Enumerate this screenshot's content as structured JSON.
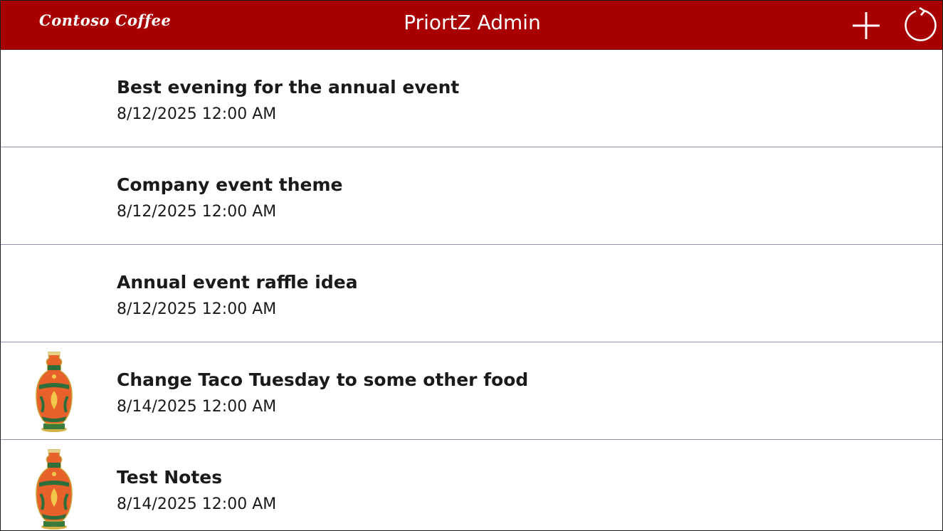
{
  "header": {
    "logo_text": "Contoso Coffee",
    "title": "PriortZ Admin",
    "bg_color": "#a80000",
    "add_icon": "plus-icon",
    "refresh_icon": "refresh-icon"
  },
  "items": [
    {
      "title": "Best evening for the annual event",
      "date": "8/12/2025 12:00 AM",
      "has_image": false
    },
    {
      "title": "Company event theme",
      "date": "8/12/2025 12:00 AM",
      "has_image": false
    },
    {
      "title": "Annual event raffle idea",
      "date": "8/12/2025 12:00 AM",
      "has_image": false
    },
    {
      "title": "Change Taco Tuesday to some other food",
      "date": "8/14/2025 12:00 AM",
      "has_image": true
    },
    {
      "title": "Test Notes",
      "date": "8/14/2025 12:00 AM",
      "has_image": true
    }
  ]
}
